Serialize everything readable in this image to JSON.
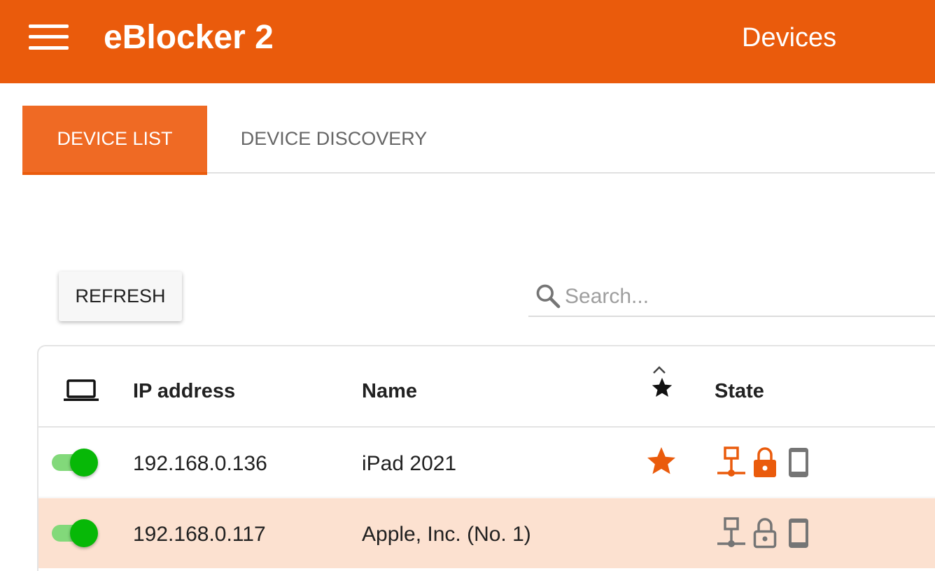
{
  "header": {
    "app_title": "eBlocker 2",
    "page_title": "Devices"
  },
  "tabs": [
    {
      "label": "DEVICE LIST",
      "active": true
    },
    {
      "label": "DEVICE DISCOVERY",
      "active": false
    }
  ],
  "toolbar": {
    "refresh_label": "REFRESH",
    "search_placeholder": "Search...",
    "search_value": ""
  },
  "table": {
    "columns": {
      "device": "laptop-icon",
      "ip": "IP address",
      "name": "Name",
      "favorite": "star-icon",
      "state": "State"
    },
    "rows": [
      {
        "enabled": true,
        "ip": "192.168.0.136",
        "name": "iPad 2021",
        "favorite": true,
        "state": {
          "network": "active",
          "locked": true,
          "device_type": "tablet"
        }
      },
      {
        "enabled": true,
        "ip": "192.168.0.117",
        "name": "Apple, Inc. (No. 1)",
        "favorite": false,
        "state": {
          "network": "inactive",
          "locked": false,
          "device_type": "tablet"
        }
      }
    ]
  },
  "colors": {
    "brand": "#ea5b0c",
    "tab_active": "#ef6a24",
    "highlight_row": "#fce1d0",
    "toggle_on": "#07b807",
    "icon_inactive": "#757575"
  }
}
